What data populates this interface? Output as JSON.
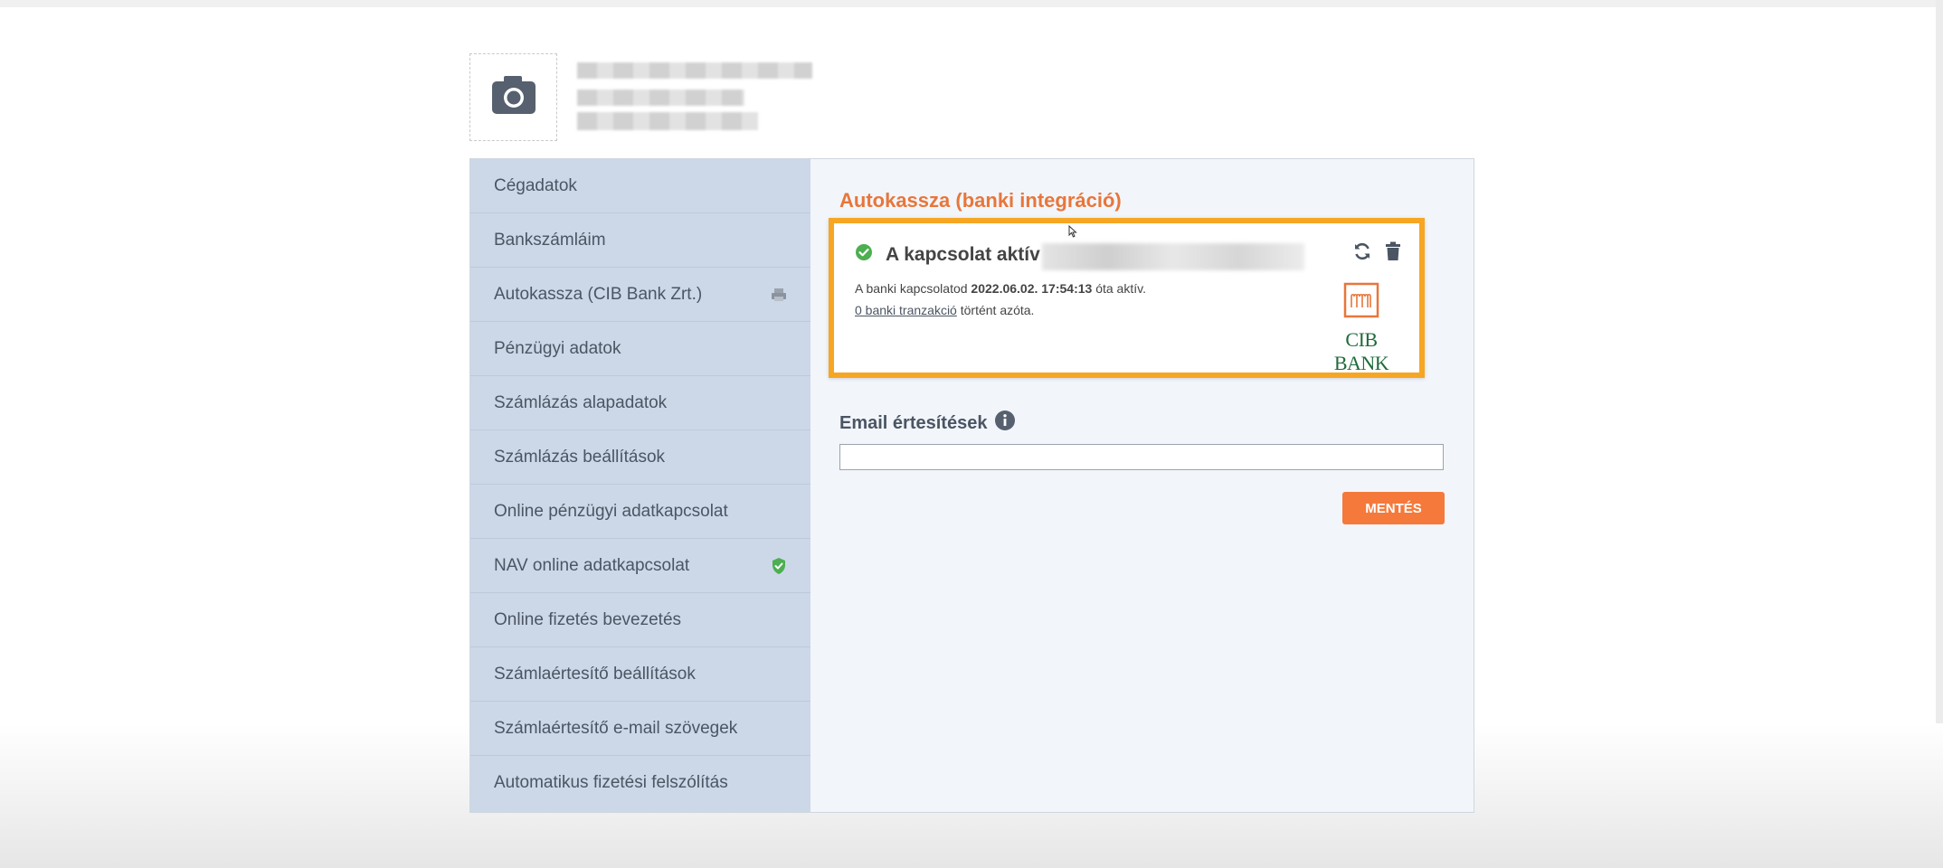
{
  "sidebar": {
    "items": [
      {
        "label": "Cégadatok"
      },
      {
        "label": "Bankszámláim"
      },
      {
        "label": "Autokassza (CIB Bank Zrt.)"
      },
      {
        "label": "Pénzügyi adatok"
      },
      {
        "label": "Számlázás alapadatok"
      },
      {
        "label": "Számlázás beállítások"
      },
      {
        "label": "Online pénzügyi adatkapcsolat"
      },
      {
        "label": "NAV online adatkapcsolat"
      },
      {
        "label": "Online fizetés bevezetés"
      },
      {
        "label": "Számlaértesítő beállítások"
      },
      {
        "label": "Számlaértesítő e-mail szövegek"
      },
      {
        "label": "Automatikus fizetési felszólítás"
      }
    ]
  },
  "main": {
    "section_title": "Autokassza (banki integráció)",
    "connection": {
      "status": "A kapcsolat aktív",
      "line1_prefix": "A banki kapcsolatod",
      "since": "2022.06.02. 17:54:13",
      "line1_suffix": "óta aktív.",
      "tx_link": "0 banki tranzakció",
      "line2_suffix": "történt azóta.",
      "bank_logo": "CIB BANK"
    },
    "email_label": "Email értesítések",
    "email_value": "",
    "save_label": "MENTÉS"
  },
  "colors": {
    "accent": "#e8763a",
    "highlight": "#f6a623",
    "save_button": "#f5793b",
    "success": "#4caf50",
    "bank_green": "#1f6b3b"
  },
  "icons": [
    "camera-icon",
    "printer-icon",
    "shield-check-icon",
    "check-circle-icon",
    "refresh-icon",
    "trash-icon",
    "info-icon"
  ]
}
